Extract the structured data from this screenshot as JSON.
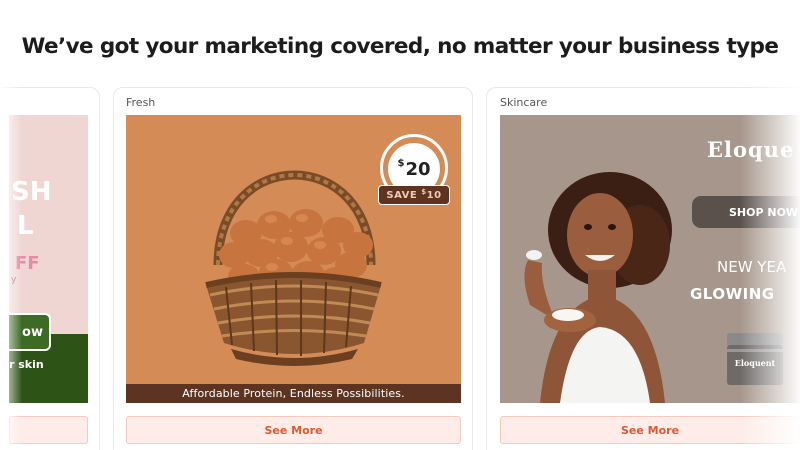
{
  "headline": "We’ve got your marketing covered, no matter your business type",
  "cards": {
    "left": {
      "partial_text_1": "SH",
      "partial_text_2": "L",
      "partial_text_3": "FF",
      "partial_text_4": "y",
      "button_label": "ow",
      "tagline": "r skin",
      "see_more": ""
    },
    "middle": {
      "label": "Fresh",
      "price_currency": "$",
      "price_value": "20",
      "save_label": "SAVE",
      "save_currency": "$",
      "save_value": "10",
      "banner": "Affordable Protein, Endless Possibilities.",
      "see_more": "See More"
    },
    "right": {
      "label": "Skincare",
      "brand": "Eloque",
      "shop_label": "SHOP NOW",
      "new_year": "NEW YEA",
      "glowing": "GLOWING",
      "jar_label": "Eloquent",
      "see_more": "See More"
    }
  },
  "colors": {
    "accent": "#e0582f",
    "see_more_bg": "#fdece8",
    "fresh_bg": "#d48b55",
    "skincare_bg": "#a6968b"
  }
}
